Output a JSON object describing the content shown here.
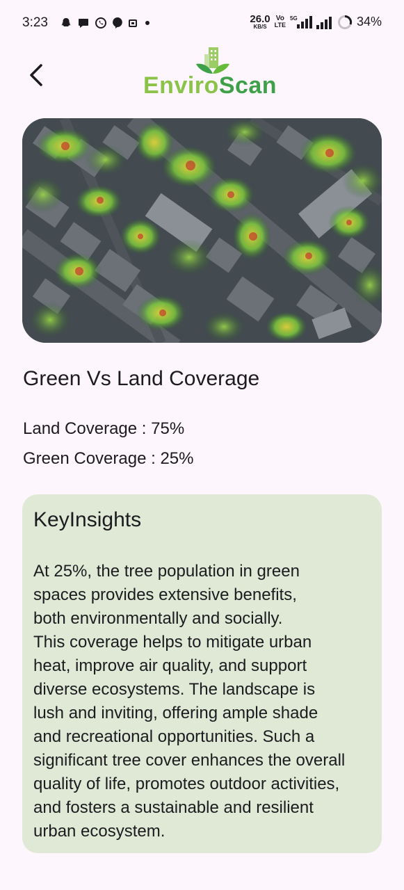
{
  "status_bar": {
    "time": "3:23",
    "net_speed_value": "26.0",
    "net_speed_unit": "KB/S",
    "volte_top": "Vo",
    "volte_bottom": "LTE",
    "network_type": "5G",
    "battery": "34%"
  },
  "header": {
    "back_icon": "chevron-left-icon",
    "logo_part1": "Enviro",
    "logo_part2": "Scan",
    "logo_icon": "building-leaf-icon"
  },
  "colors": {
    "background": "#fdf7fd",
    "card": "#dfe9d6",
    "logo_light_green": "#8bc34a",
    "logo_green": "#3fa04a"
  },
  "coverage": {
    "title": "Green Vs Land Coverage",
    "land_label": "Land Coverage : ",
    "land_value": "75%",
    "green_label": "Green Coverage : ",
    "green_value": "25%"
  },
  "insights": {
    "title": "KeyInsights",
    "body": "At 25%, the tree population in green\nspaces provides extensive benefits,\nboth environmentally and socially.\nThis coverage helps to mitigate urban\nheat, improve air quality, and support\ndiverse ecosystems. The landscape is\nlush and inviting, offering ample shade\nand recreational opportunities. Such a\nsignificant tree cover enhances the overall\nquality of life, promotes outdoor activities,\nand fosters a sustainable and resilient\nurban ecosystem."
  }
}
